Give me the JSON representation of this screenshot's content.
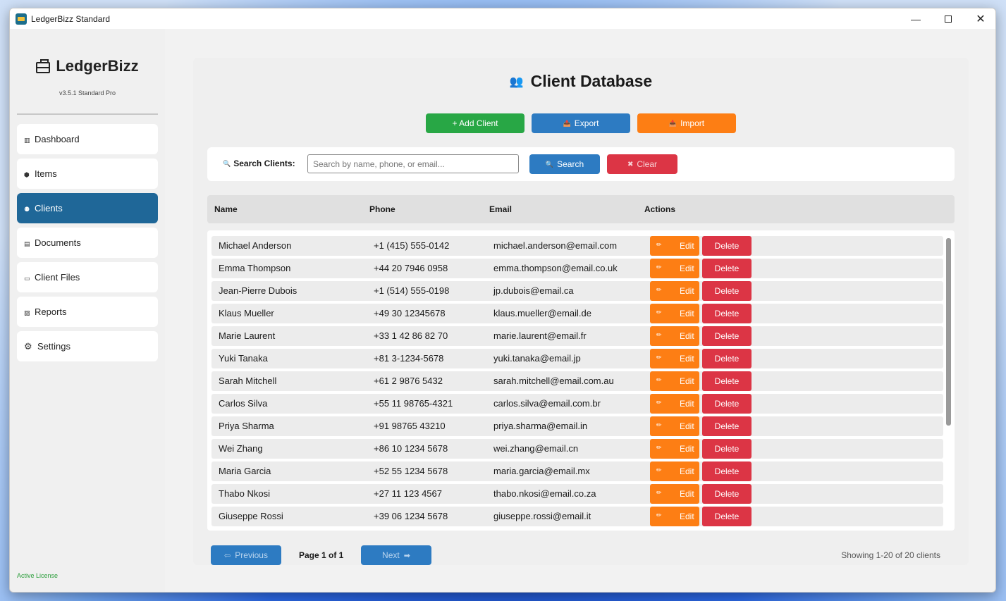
{
  "window": {
    "title": "LedgerBizz Standard"
  },
  "sidebar": {
    "brand": "LedgerBizz",
    "version": "v3.5.1 Standard Pro",
    "items": [
      {
        "label": "Dashboard",
        "icon": "dashboard-icon",
        "glyph": "▥"
      },
      {
        "label": "Items",
        "icon": "box-icon",
        "glyph": "⬢"
      },
      {
        "label": "Clients",
        "icon": "people-icon",
        "glyph": "⚉"
      },
      {
        "label": "Documents",
        "icon": "document-icon",
        "glyph": "▤"
      },
      {
        "label": "Client Files",
        "icon": "folder-icon",
        "glyph": "▭"
      },
      {
        "label": "Reports",
        "icon": "chart-icon",
        "glyph": "▨"
      },
      {
        "label": "Settings",
        "icon": "gear-icon",
        "glyph": "⚙"
      }
    ],
    "active_item": "Clients",
    "license": "Active License"
  },
  "main": {
    "title": "Client Database",
    "add_client_label": "+ Add Client",
    "export_label": "Export",
    "import_label": "Import",
    "search": {
      "label": "Search Clients:",
      "placeholder": "Search by name, phone, or email...",
      "value": "",
      "search_label": "Search",
      "clear_label": "Clear"
    },
    "table": {
      "columns": [
        "Name",
        "Phone",
        "Email",
        "Actions"
      ],
      "edit_label": "Edit",
      "delete_label": "Delete",
      "rows": [
        {
          "name": "Michael Anderson",
          "phone": "+1 (415) 555-0142",
          "email": "michael.anderson@email.com"
        },
        {
          "name": "Emma Thompson",
          "phone": "+44 20 7946 0958",
          "email": "emma.thompson@email.co.uk"
        },
        {
          "name": "Jean-Pierre Dubois",
          "phone": "+1 (514) 555-0198",
          "email": "jp.dubois@email.ca"
        },
        {
          "name": "Klaus Mueller",
          "phone": "+49 30 12345678",
          "email": "klaus.mueller@email.de"
        },
        {
          "name": "Marie Laurent",
          "phone": "+33 1 42 86 82 70",
          "email": "marie.laurent@email.fr"
        },
        {
          "name": "Yuki Tanaka",
          "phone": "+81 3-1234-5678",
          "email": "yuki.tanaka@email.jp"
        },
        {
          "name": "Sarah Mitchell",
          "phone": "+61 2 9876 5432",
          "email": "sarah.mitchell@email.com.au"
        },
        {
          "name": "Carlos Silva",
          "phone": "+55 11 98765-4321",
          "email": "carlos.silva@email.com.br"
        },
        {
          "name": "Priya Sharma",
          "phone": "+91 98765 43210",
          "email": "priya.sharma@email.in"
        },
        {
          "name": "Wei Zhang",
          "phone": "+86 10 1234 5678",
          "email": "wei.zhang@email.cn"
        },
        {
          "name": "Maria Garcia",
          "phone": "+52 55 1234 5678",
          "email": "maria.garcia@email.mx"
        },
        {
          "name": "Thabo Nkosi",
          "phone": "+27 11 123 4567",
          "email": "thabo.nkosi@email.co.za"
        },
        {
          "name": "Giuseppe Rossi",
          "phone": "+39 06 1234 5678",
          "email": "giuseppe.rossi@email.it"
        }
      ]
    },
    "pagination": {
      "previous_label": "Previous",
      "next_label": "Next",
      "page_info": "Page 1 of 1",
      "showing": "Showing 1-20 of 20 clients"
    }
  },
  "colors": {
    "accent_blue": "#2d7bc2",
    "active_nav": "#1f6798",
    "add_green": "#28a745",
    "import_orange": "#fd7e14",
    "delete_red": "#dc3545",
    "license_green": "#2a9d3a"
  }
}
